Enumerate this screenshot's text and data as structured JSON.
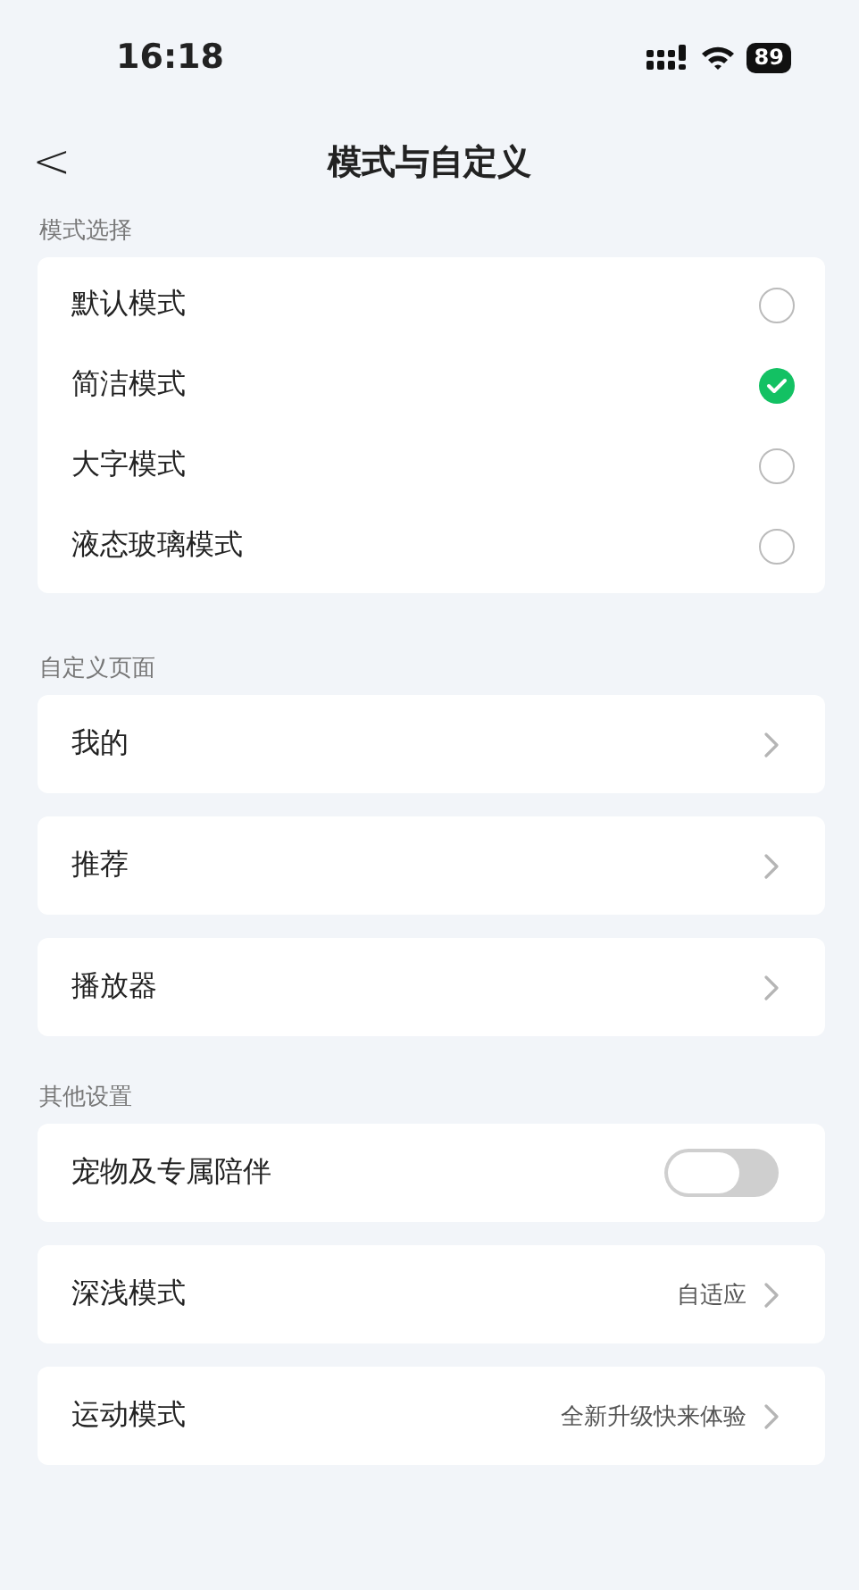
{
  "status_bar": {
    "time": "16:18",
    "battery": "89"
  },
  "nav": {
    "back": "<",
    "title": "模式与自定义"
  },
  "mode_section": {
    "label": "模式选择",
    "options": [
      {
        "label": "默认模式",
        "selected": false
      },
      {
        "label": "简洁模式",
        "selected": true
      },
      {
        "label": "大字模式",
        "selected": false
      },
      {
        "label": "液态玻璃模式",
        "selected": false
      }
    ]
  },
  "custom_section": {
    "label": "自定义页面",
    "items": [
      {
        "kind": "link",
        "label": "我的"
      },
      {
        "kind": "link",
        "label": "推荐"
      },
      {
        "kind": "link",
        "label": "播放器"
      }
    ]
  },
  "other_section": {
    "label": "其他设置",
    "items": [
      {
        "kind": "toggle",
        "label": "宠物及专属陪伴",
        "on": false
      },
      {
        "kind": "link",
        "label": "深浅模式",
        "value": "自适应"
      },
      {
        "kind": "link",
        "label": "运动模式",
        "value": "全新升级快来体验"
      }
    ]
  }
}
